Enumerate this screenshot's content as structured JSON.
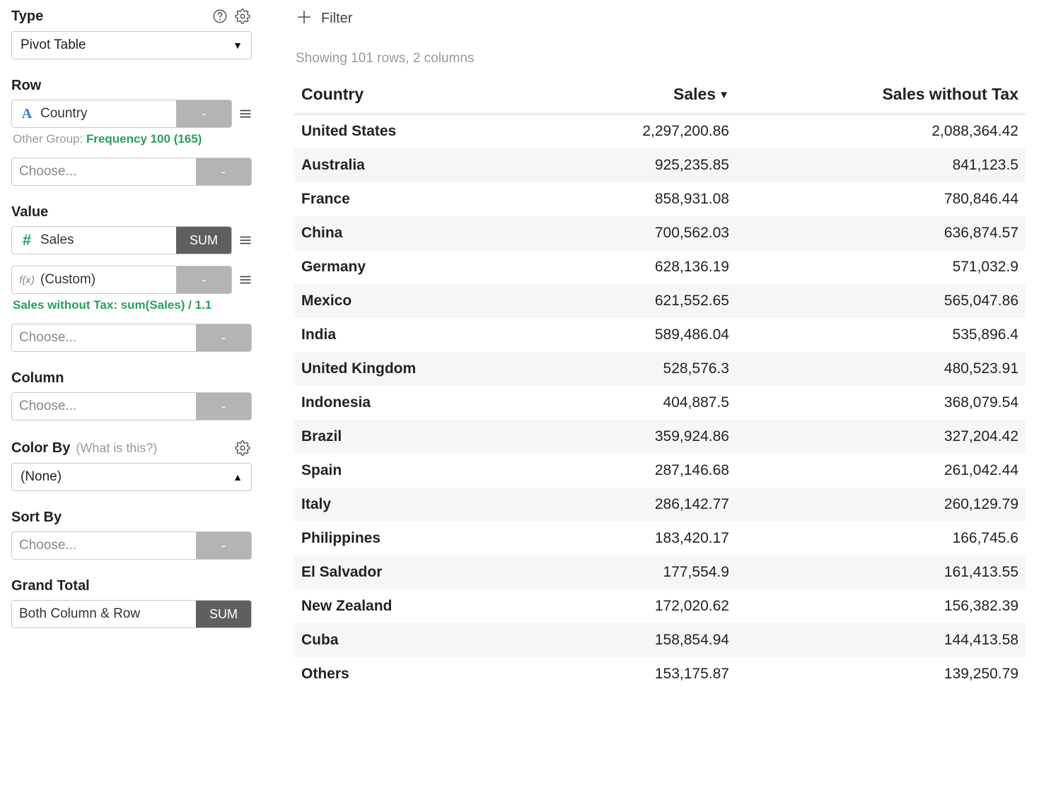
{
  "sidebar": {
    "type": {
      "label": "Type",
      "value": "Pivot Table"
    },
    "row": {
      "label": "Row",
      "fields": [
        {
          "icon": "text",
          "name": "Country",
          "agg": "-",
          "agg_style": "light"
        }
      ],
      "group_prefix": "Other Group: ",
      "group_value": "Frequency 100 (165)",
      "choose_placeholder": "Choose...",
      "choose_agg": "-"
    },
    "value": {
      "label": "Value",
      "fields": [
        {
          "icon": "num",
          "name": "Sales",
          "agg": "SUM",
          "agg_style": "dark"
        },
        {
          "icon": "fx",
          "name": "(Custom)",
          "agg": "-",
          "agg_style": "light"
        }
      ],
      "formula": "Sales without Tax: sum(Sales) / 1.1",
      "choose_placeholder": "Choose...",
      "choose_agg": "-"
    },
    "column": {
      "label": "Column",
      "choose_placeholder": "Choose...",
      "choose_agg": "-"
    },
    "colorby": {
      "label": "Color By",
      "hint": "(What is this?)",
      "value": "(None)"
    },
    "sortby": {
      "label": "Sort By",
      "choose_placeholder": "Choose...",
      "choose_agg": "-"
    },
    "grandtotal": {
      "label": "Grand Total",
      "value": "Both Column & Row",
      "agg": "SUM"
    }
  },
  "main": {
    "filter_label": "Filter",
    "status": "Showing 101 rows, 2 columns",
    "columns": [
      {
        "key": "country",
        "label": "Country",
        "numeric": false,
        "sorted": false
      },
      {
        "key": "sales",
        "label": "Sales",
        "numeric": true,
        "sorted": "desc"
      },
      {
        "key": "sales_no_tax",
        "label": "Sales without Tax",
        "numeric": true,
        "sorted": false
      }
    ],
    "rows": [
      {
        "country": "United States",
        "sales": "2,297,200.86",
        "sales_no_tax": "2,088,364.42"
      },
      {
        "country": "Australia",
        "sales": "925,235.85",
        "sales_no_tax": "841,123.5"
      },
      {
        "country": "France",
        "sales": "858,931.08",
        "sales_no_tax": "780,846.44"
      },
      {
        "country": "China",
        "sales": "700,562.03",
        "sales_no_tax": "636,874.57"
      },
      {
        "country": "Germany",
        "sales": "628,136.19",
        "sales_no_tax": "571,032.9"
      },
      {
        "country": "Mexico",
        "sales": "621,552.65",
        "sales_no_tax": "565,047.86"
      },
      {
        "country": "India",
        "sales": "589,486.04",
        "sales_no_tax": "535,896.4"
      },
      {
        "country": "United Kingdom",
        "sales": "528,576.3",
        "sales_no_tax": "480,523.91"
      },
      {
        "country": "Indonesia",
        "sales": "404,887.5",
        "sales_no_tax": "368,079.54"
      },
      {
        "country": "Brazil",
        "sales": "359,924.86",
        "sales_no_tax": "327,204.42"
      },
      {
        "country": "Spain",
        "sales": "287,146.68",
        "sales_no_tax": "261,042.44"
      },
      {
        "country": "Italy",
        "sales": "286,142.77",
        "sales_no_tax": "260,129.79"
      },
      {
        "country": "Philippines",
        "sales": "183,420.17",
        "sales_no_tax": "166,745.6"
      },
      {
        "country": "El Salvador",
        "sales": "177,554.9",
        "sales_no_tax": "161,413.55"
      },
      {
        "country": "New Zealand",
        "sales": "172,020.62",
        "sales_no_tax": "156,382.39"
      },
      {
        "country": "Cuba",
        "sales": "158,854.94",
        "sales_no_tax": "144,413.58"
      },
      {
        "country": "Others",
        "sales": "153,175.87",
        "sales_no_tax": "139,250.79"
      }
    ]
  }
}
